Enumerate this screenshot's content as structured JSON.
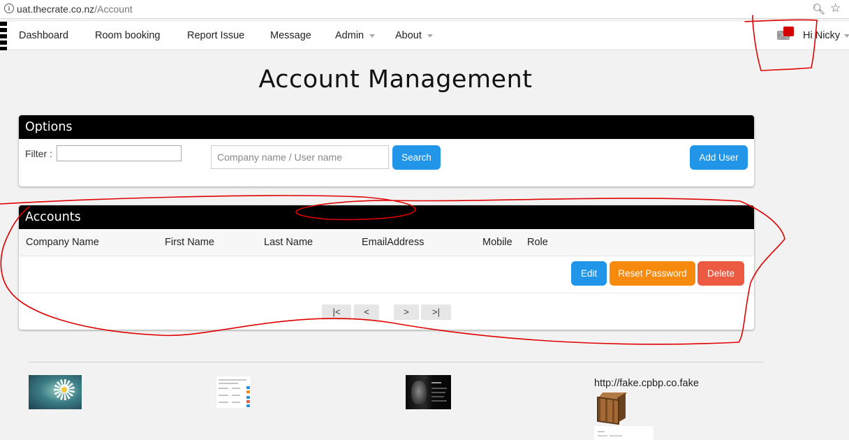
{
  "browser": {
    "url_host": "uat.thecrate.co.nz",
    "url_path": "/Account",
    "info_icon": "info-icon",
    "zoom_icon": "zoom-icon",
    "bookmark_icon": "star-icon"
  },
  "navbar": {
    "items": [
      {
        "label": "Dashboard"
      },
      {
        "label": "Room booking"
      },
      {
        "label": "Report Issue"
      },
      {
        "label": "Message"
      },
      {
        "label": "Admin",
        "dropdown": true
      },
      {
        "label": "About",
        "dropdown": true
      }
    ],
    "user_greeting": "Hi Nicky",
    "badge_color": "#d40000"
  },
  "page": {
    "title": "Account Management"
  },
  "options_panel": {
    "heading": "Options",
    "filter_label": "Filter :",
    "filter_value": "",
    "search_placeholder": "Company name / User name",
    "search_button": "Search",
    "add_user_button": "Add User"
  },
  "accounts_panel": {
    "heading": "Accounts",
    "columns": [
      "Company Name",
      "First Name",
      "Last Name",
      "EmailAddress",
      "Mobile",
      "Role"
    ],
    "row_actions": {
      "edit": "Edit",
      "reset_password": "Reset Password",
      "delete": "Delete"
    },
    "pager": {
      "first": "|<",
      "prev": "<",
      "next": ">",
      "last": ">|"
    }
  },
  "footer": {
    "link_text": "http://fake.cpbp.co.fake"
  },
  "colors": {
    "primary": "#2196e8",
    "warning": "#f7890c",
    "danger": "#ec5a42",
    "panel_header": "#000000",
    "annotation": "#e00000"
  }
}
